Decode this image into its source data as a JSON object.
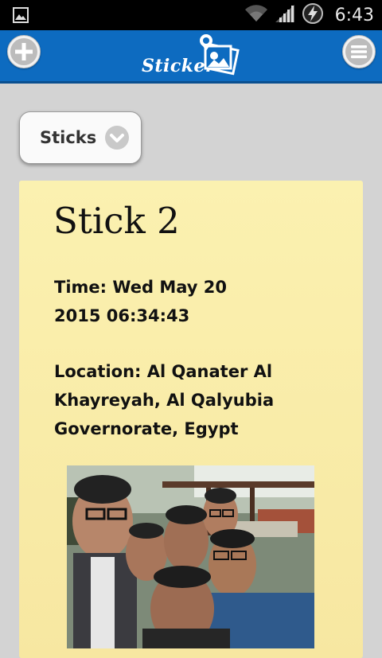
{
  "status_bar": {
    "time": "6:43",
    "icons": [
      "gallery-notification-icon",
      "wifi-icon",
      "signal-icon",
      "battery-charging-icon"
    ]
  },
  "app_bar": {
    "title": "Sticker",
    "left_button_icon": "plus-icon",
    "right_button_icon": "menu-icon",
    "color": "#0d6bc0"
  },
  "dropdown": {
    "selected": "Sticks"
  },
  "stick": {
    "title": "Stick 2",
    "time_text": "Time: Wed May 20 2015 06:34:43",
    "location_text": "Location: Al Qanater Al Khayreyah, Al Qalyubia Governorate, Egypt",
    "card_color": "#fbf1b0"
  }
}
